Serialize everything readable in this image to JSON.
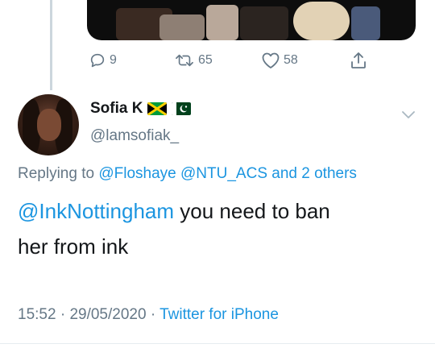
{
  "thread": {
    "actions": {
      "replies": "9",
      "retweets": "65",
      "likes": "58"
    }
  },
  "tweet": {
    "display_name": "Sofia K",
    "handle": "@lamsofiak_",
    "flags": [
      "jamaica-flag",
      "pakistan-flag"
    ],
    "replying_prefix": "Replying to",
    "replying_mentions": [
      "@Floshaye",
      "@NTU_ACS"
    ],
    "replying_suffix": "and 2 others",
    "text_mention": "@InkNottingham",
    "text_line1_rest": " you need to ban",
    "text_line2": "her from ink",
    "time": "15:52",
    "date": "29/05/2020",
    "separator": "·",
    "source": "Twitter for iPhone"
  },
  "colors": {
    "link": "#1b95e0",
    "muted": "#657786",
    "text": "#14171a"
  }
}
